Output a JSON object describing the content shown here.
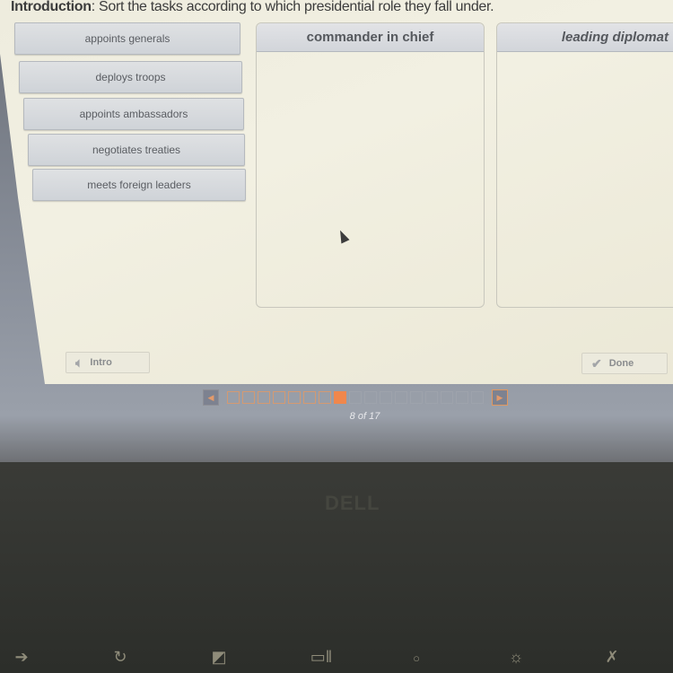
{
  "instructions": {
    "label": "Introduction",
    "text": ": Sort the tasks according to which presidential role they fall under."
  },
  "tiles": [
    {
      "label": "appoints generals"
    },
    {
      "label": "deploys troops"
    },
    {
      "label": "appoints ambassadors"
    },
    {
      "label": "negotiates treaties"
    },
    {
      "label": "meets foreign leaders"
    }
  ],
  "bins": [
    {
      "title": "commander in chief",
      "items": []
    },
    {
      "title": "leading diplomat",
      "items": []
    }
  ],
  "buttons": {
    "intro_label": "Intro",
    "intro_icon": "speaker-icon",
    "done_label": "Done",
    "done_icon": "checkmark-icon"
  },
  "pagination": {
    "current": 8,
    "total": 17,
    "label": "8 of 17",
    "prev_icon": "◀",
    "next_icon": "▶"
  },
  "colors": {
    "accent": "#f0874c",
    "panel_bg": "#f2f0e2",
    "tile_bg": "#d6d9dd"
  },
  "device": {
    "logo": "DELL",
    "function_keys": [
      {
        "name": "forward-icon",
        "glyph": "➔"
      },
      {
        "name": "refresh-icon",
        "glyph": "↻"
      },
      {
        "name": "fullscreen-icon",
        "glyph": "◩"
      },
      {
        "name": "overview-icon",
        "glyph": "▭ǁ"
      },
      {
        "name": "brightness-down-icon",
        "glyph": "○"
      },
      {
        "name": "brightness-up-icon",
        "glyph": "☼"
      },
      {
        "name": "mute-icon",
        "glyph": "✗"
      }
    ]
  }
}
